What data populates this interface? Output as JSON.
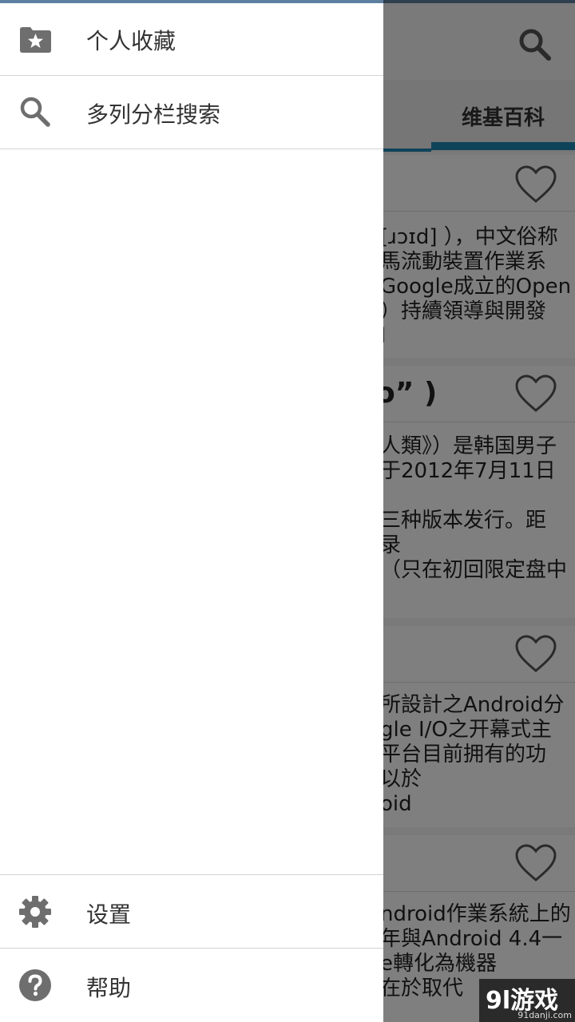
{
  "app": {
    "tab_active": "维基百科"
  },
  "cards": [
    {
      "title": "",
      "lines": [
        "[ɹɔɪd] ），中文俗称",
        "馬流動裝置作業系",
        " Google成立的Open",
        "）持續領導與開發",
        "l"
      ]
    },
    {
      "title": "o” )",
      "lines": [
        "人類》）是韩国男子",
        "于2012年7月11日",
        "",
        "三种版本发行。距",
        "录",
        "（只在初回限定盘中"
      ]
    },
    {
      "title": "",
      "lines": [
        "所設計之Android分",
        "gle I/O之开幕式主",
        "平台目前拥有的功",
        "以於",
        "oid"
      ]
    },
    {
      "title": "",
      "lines": [
        "ndroid作業系統上的",
        "年與Android 4.4一",
        "e轉化為機器",
        "在於取代"
      ]
    }
  ],
  "drawer": {
    "items": [
      {
        "label": "个人收藏",
        "icon": "star-folder-icon"
      },
      {
        "label": "多列分栏搜索",
        "icon": "search-icon"
      }
    ],
    "footer": [
      {
        "label": "设置",
        "icon": "gear-icon"
      },
      {
        "label": "帮助",
        "icon": "help-icon"
      }
    ]
  },
  "watermark": {
    "logo": "9l游戏",
    "site": "91danji.com"
  },
  "colors": {
    "accent": "#1f87b3",
    "top_line": "#5d7fa0",
    "icon_gray": "#6e6e6e"
  }
}
